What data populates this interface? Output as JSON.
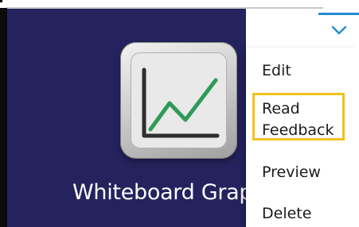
{
  "card": {
    "app_name": "Whiteboard Graph",
    "colors": {
      "card_background": "#25235e",
      "graph_line": "#2f9a5a",
      "axis": "#333333"
    }
  },
  "dropdown": {
    "toggle_icon": "chevron-down-icon",
    "accent_color": "#1f8fd0",
    "highlight_color": "#f3c11a",
    "items": [
      {
        "label": "Edit"
      },
      {
        "label_line1": "Read",
        "label_line2": "Feedback"
      },
      {
        "label": "Preview"
      },
      {
        "label": "Delete"
      }
    ]
  }
}
